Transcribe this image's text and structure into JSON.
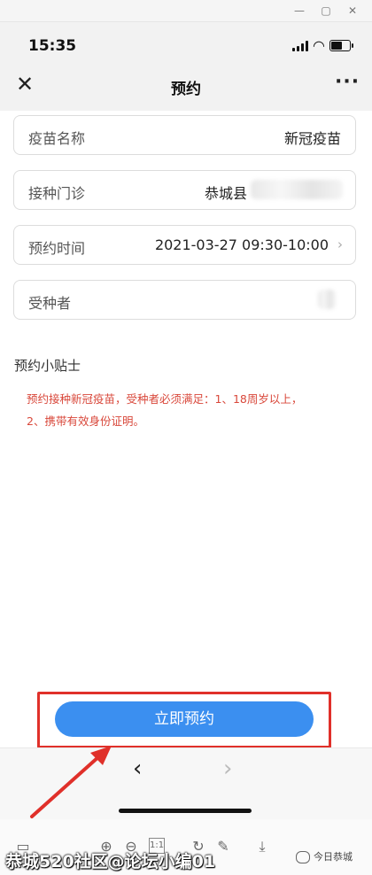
{
  "status_bar": {
    "time": "15:35"
  },
  "header": {
    "title": "预约",
    "close_icon": "close-icon",
    "more_icon": "more-icon"
  },
  "form": {
    "vaccine": {
      "label": "疫苗名称",
      "value": "新冠疫苗"
    },
    "clinic": {
      "label": "接种门诊",
      "value": "恭城县"
    },
    "time": {
      "label": "预约时间",
      "value": "2021-03-27 09:30-10:00"
    },
    "recipient": {
      "label": "受种者",
      "value": ""
    }
  },
  "tips": {
    "title": "预约小贴士",
    "line1": "预约接种新冠疫苗，受种者必须满足：1、18周岁以上，",
    "line2": "2、携带有效身份证明。"
  },
  "actions": {
    "book_label": "立即预约"
  },
  "watermark": "恭城520社区@论坛小编01",
  "wechat_badge": "今日恭城",
  "colors": {
    "accent": "#3b8ff0",
    "tips": "#d9483b",
    "annotation": "#e0302a"
  }
}
